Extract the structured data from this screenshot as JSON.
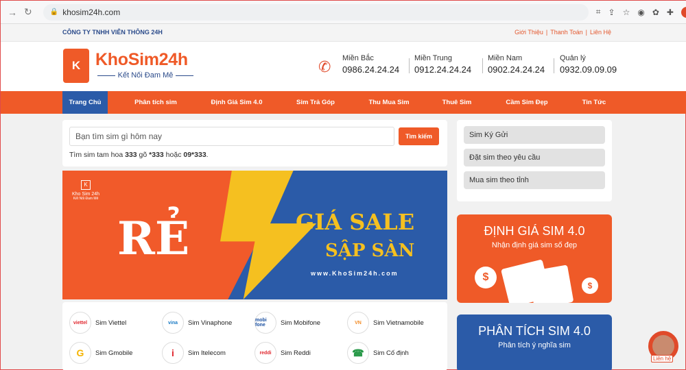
{
  "browser": {
    "url": "khosim24h.com"
  },
  "topbar": {
    "company": "CÔNG TY TNHH VIỄN THÔNG 24H",
    "links": [
      "Giới Thiệu",
      "Thanh Toán",
      "Liên Hệ"
    ],
    "sep": "|"
  },
  "header": {
    "logo_mark": "K",
    "logo_text": "KhoSim24h",
    "slogan": "Kết Nối Đam Mê",
    "hotlines": [
      {
        "label": "Miền Bắc",
        "number": "0986.24.24.24"
      },
      {
        "label": "Miền Trung",
        "number": "0912.24.24.24"
      },
      {
        "label": "Miền Nam",
        "number": "0902.24.24.24"
      },
      {
        "label": "Quản lý",
        "number": "0932.09.09.09"
      }
    ]
  },
  "menu": {
    "items": [
      "Trang Chủ",
      "Phân tích sim",
      "Định Giá Sim 4.0",
      "Sim Trả Góp",
      "Thu Mua Sim",
      "Thuê Sim",
      "Cầm Sim Đẹp",
      "Tin Tức"
    ],
    "active_index": 0
  },
  "search": {
    "placeholder": "Bạn tìm sim gì hôm nay",
    "button": "Tìm kiếm",
    "hint_prefix": "Tìm sim tam hoa ",
    "hint_b1": "333",
    "hint_mid1": " gõ ",
    "hint_b2": "*333",
    "hint_mid2": " hoặc ",
    "hint_b3": "09*333",
    "hint_suffix": "."
  },
  "banner": {
    "logo_text": "Kho Sim 24h",
    "logo_sub": "Kết Nối Đam Mê",
    "logo_mark": "K",
    "big": "RẺ",
    "sale": "GIÁ SALE",
    "sale2": "SẬP SÀN",
    "url": "www.KhoSim24h.com"
  },
  "carriers": [
    {
      "name": "Sim Viettel",
      "icon": "viettel"
    },
    {
      "name": "Sim Vinaphone",
      "icon": "vina"
    },
    {
      "name": "Sim Mobifone",
      "icon": "mobi\nfone"
    },
    {
      "name": "Sim Vietnamobile",
      "icon": "VN"
    },
    {
      "name": "Sim Gmobile",
      "icon": "G"
    },
    {
      "name": "Sim Itelecom",
      "icon": "i"
    },
    {
      "name": "Sim Reddi",
      "icon": "reddi"
    },
    {
      "name": "Sim Cố định",
      "icon": "☎"
    }
  ],
  "sidebar": {
    "buttons": [
      "Sim Ký Gửi",
      "Đặt sim theo yêu cầu",
      "Mua sim theo tỉnh"
    ]
  },
  "promo1": {
    "title": "ĐỊNH GIÁ SIM 4.0",
    "subtitle": "Nhận định giá sim số đẹp"
  },
  "promo2": {
    "title": "PHÂN TÍCH SIM 4.0",
    "subtitle": "Phân tích ý nghĩa sim"
  },
  "livechat": {
    "label": "Liên hệ"
  },
  "colors": {
    "brand_orange": "#ef5a28",
    "brand_blue": "#2b5ba8",
    "banner_yellow": "#f5c020"
  }
}
